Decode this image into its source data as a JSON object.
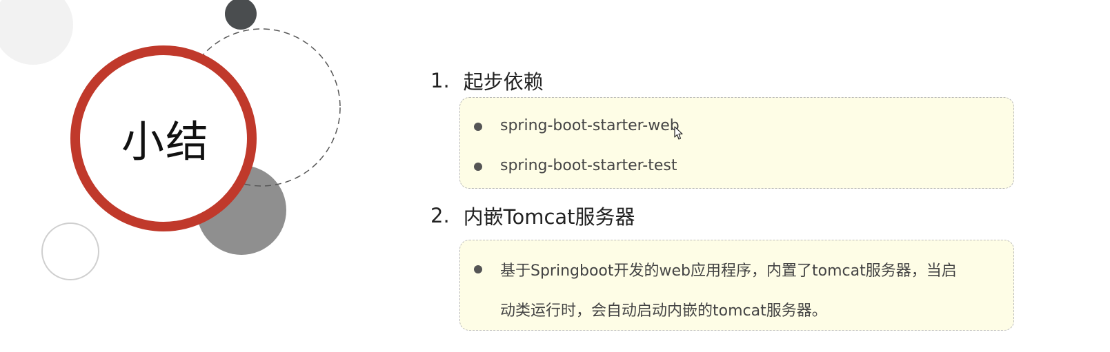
{
  "slide": {
    "title": "小结",
    "sections": [
      {
        "number": "1.",
        "heading": "起步依赖",
        "items": [
          "spring-boot-starter-web",
          "spring-boot-starter-test"
        ]
      },
      {
        "number": "2.",
        "heading": "内嵌Tomcat服务器",
        "items": [
          {
            "line1": "基于Springboot开发的web应用程序，内置了tomcat服务器，当启",
            "line2": "动类运行时，会自动启动内嵌的tomcat服务器。"
          }
        ]
      }
    ]
  },
  "colors": {
    "ring": "#c0392b",
    "box_background": "#fefde6",
    "dark_circle": "#4a4d4f",
    "gray_circle": "#8f8f8f",
    "light_circle": "#f2f2f2"
  },
  "icons": {
    "bullet": "filled-circle",
    "cursor": "mouse-pointer-icon"
  }
}
